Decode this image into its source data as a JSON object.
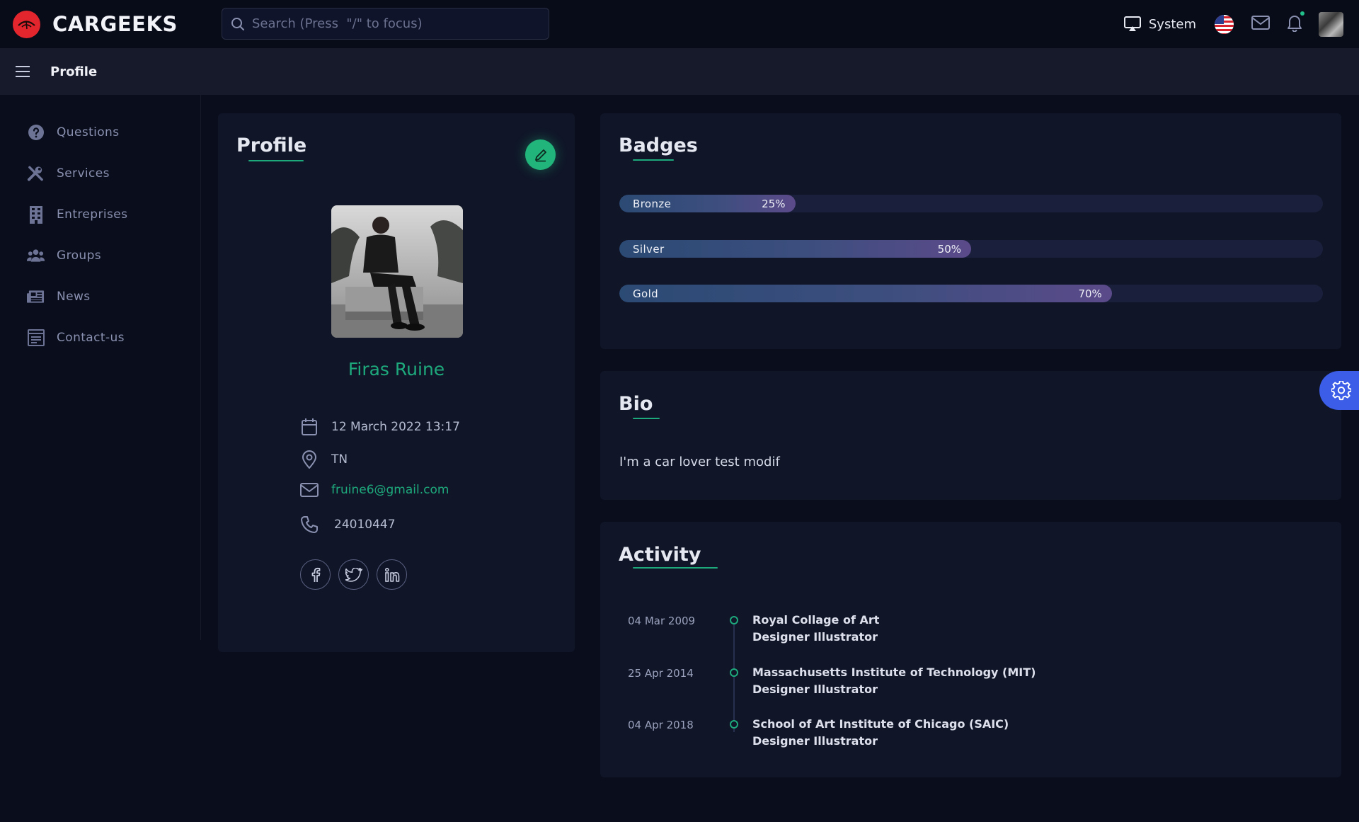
{
  "app": {
    "brand": "CARGEEKS"
  },
  "search": {
    "placeholder": "Search (Press  \"/\" to focus)"
  },
  "header": {
    "system_label": "System"
  },
  "subheader": {
    "title": "Profile"
  },
  "sidebar": {
    "items": [
      {
        "label": "Questions",
        "icon": "question-circle-icon"
      },
      {
        "label": "Services",
        "icon": "tools-icon"
      },
      {
        "label": "Entreprises",
        "icon": "building-icon"
      },
      {
        "label": "Groups",
        "icon": "users-icon"
      },
      {
        "label": "News",
        "icon": "newspaper-icon"
      },
      {
        "label": "Contact-us",
        "icon": "contact-form-icon"
      }
    ]
  },
  "profile": {
    "title": "Profile",
    "name": "Firas Ruine",
    "date": "12 March 2022 13:17",
    "location": "TN",
    "email": "fruine6@gmail.com",
    "phone": "24010447",
    "socials": [
      "facebook-icon",
      "twitter-icon",
      "linkedin-icon"
    ]
  },
  "badges": {
    "title": "Badges",
    "items": [
      {
        "label": "Bronze",
        "percent": 25,
        "percent_label": "25%"
      },
      {
        "label": "Silver",
        "percent": 50,
        "percent_label": "50%"
      },
      {
        "label": "Gold",
        "percent": 70,
        "percent_label": "70%"
      }
    ]
  },
  "bio": {
    "title": "Bio",
    "text": "I'm a car lover test modif"
  },
  "activity": {
    "title": "Activity",
    "items": [
      {
        "date": "04 Mar 2009",
        "org": "Royal Collage of Art",
        "role": "Designer Illustrator"
      },
      {
        "date": "25 Apr 2014",
        "org": "Massachusetts Institute of Technology (MIT)",
        "role": "Designer Illustrator"
      },
      {
        "date": "04 Apr 2018",
        "org": "School of Art Institute of Chicago (SAIC)",
        "role": "Designer Illustrator"
      }
    ]
  },
  "colors": {
    "accent": "#1ea97c",
    "brand_red": "#e3262e",
    "fab_blue": "#3b5de7",
    "background": "#0a0d1c",
    "card": "#101628"
  }
}
